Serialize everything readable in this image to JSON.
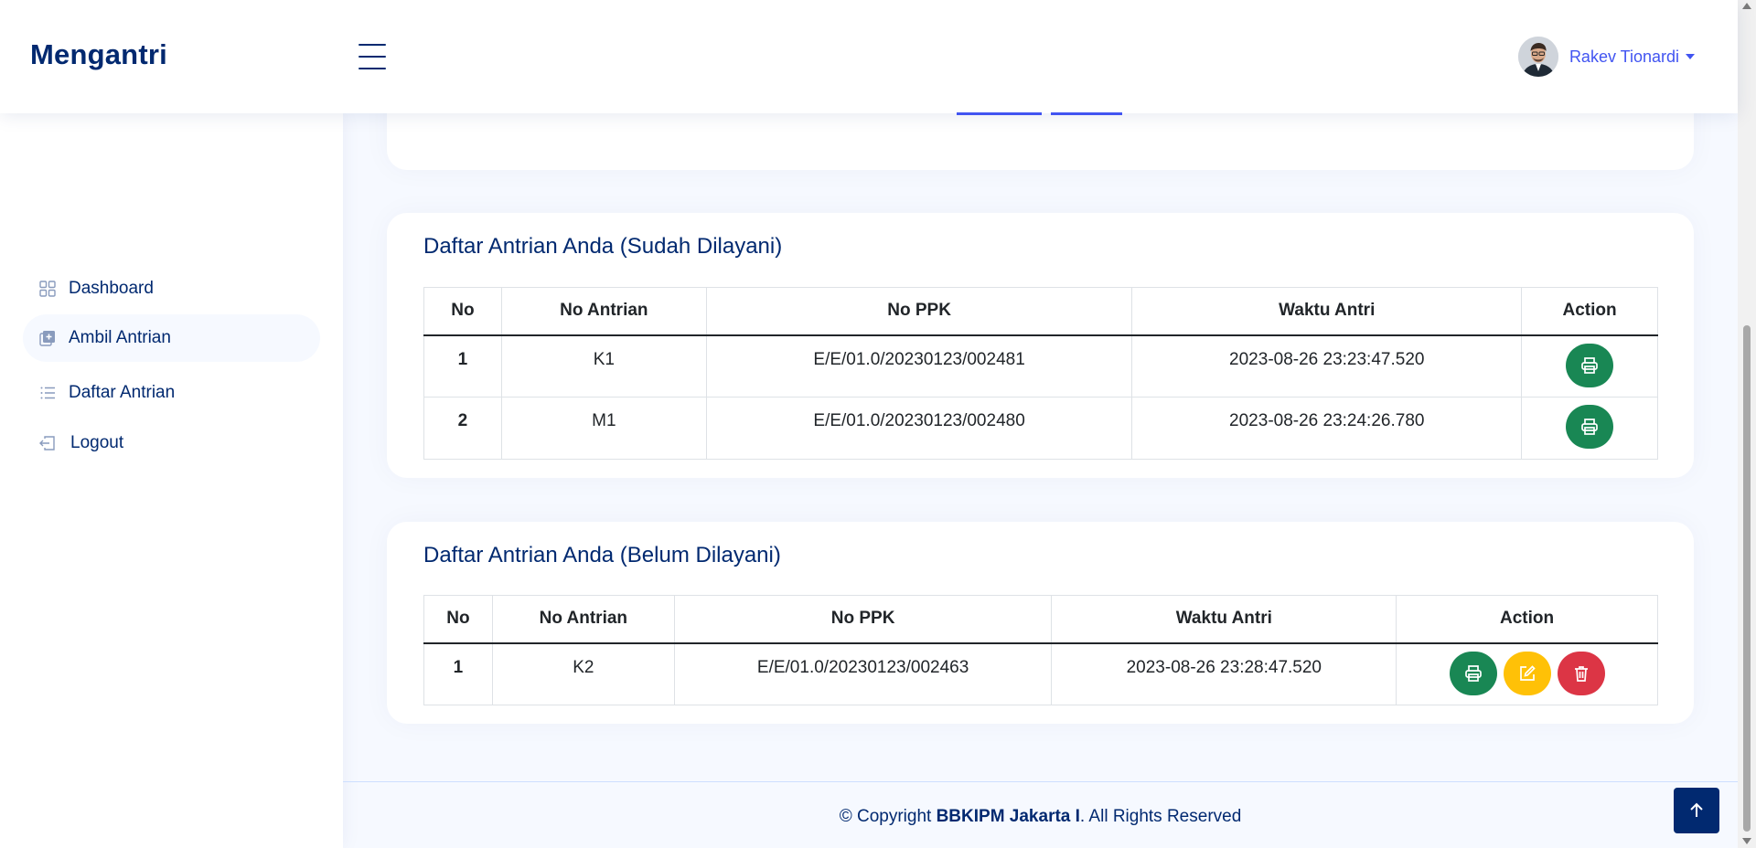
{
  "app": {
    "title": "Mengantri"
  },
  "user": {
    "name": "Rakev Tionardi"
  },
  "sidebar": {
    "items": [
      {
        "label": "Dashboard",
        "icon": "grid-icon",
        "active": false
      },
      {
        "label": "Ambil Antrian",
        "icon": "plus-square-icon",
        "active": true
      },
      {
        "label": "Daftar Antrian",
        "icon": "list-icon",
        "active": false
      },
      {
        "label": "Logout",
        "icon": "box-arrow-in-left-icon",
        "active": false
      }
    ]
  },
  "served": {
    "title": "Daftar Antrian Anda (Sudah Dilayani)",
    "columns": [
      "No",
      "No Antrian",
      "No PPK",
      "Waktu Antri",
      "Action"
    ],
    "rows": [
      {
        "no": "1",
        "antrian": "K1",
        "ppk": "E/E/01.0/20230123/002481",
        "waktu": "2023-08-26 23:23:47.520"
      },
      {
        "no": "2",
        "antrian": "M1",
        "ppk": "E/E/01.0/20230123/002480",
        "waktu": "2023-08-26 23:24:26.780"
      }
    ]
  },
  "pending": {
    "title": "Daftar Antrian Anda (Belum Dilayani)",
    "columns": [
      "No",
      "No Antrian",
      "No PPK",
      "Waktu Antri",
      "Action"
    ],
    "rows": [
      {
        "no": "1",
        "antrian": "K2",
        "ppk": "E/E/01.0/20230123/002463",
        "waktu": "2023-08-26 23:28:47.520"
      }
    ]
  },
  "footer": {
    "prefix": "© Copyright ",
    "org": "BBKIPM Jakarta I",
    "suffix": ". All Rights Reserved"
  },
  "colors": {
    "primary": "#012970",
    "accent": "#4154f1",
    "print": "#198754",
    "edit": "#ffc107",
    "delete": "#dc3545"
  }
}
